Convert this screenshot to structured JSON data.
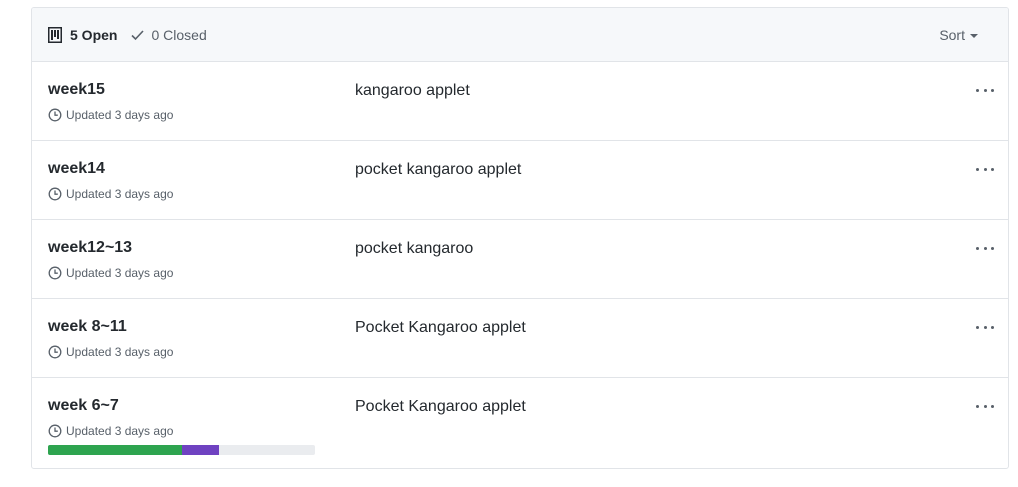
{
  "header": {
    "open_label": "5 Open",
    "closed_label": "0 Closed",
    "sort_label": "Sort"
  },
  "projects": [
    {
      "name": "week15",
      "updated": "Updated 3 days ago",
      "description": "kangaroo applet"
    },
    {
      "name": "week14",
      "updated": "Updated 3 days ago",
      "description": "pocket kangaroo applet"
    },
    {
      "name": "week12~13",
      "updated": "Updated 3 days ago",
      "description": "pocket kangaroo"
    },
    {
      "name": "week 8~11",
      "updated": "Updated 3 days ago",
      "description": "Pocket Kangaroo applet"
    },
    {
      "name": "week 6~7",
      "updated": "Updated 3 days ago",
      "description": "Pocket Kangaroo applet",
      "progress": {
        "done_fraction": 0.5,
        "in_progress_fraction": 0.14
      }
    }
  ],
  "colors": {
    "done": "#2ea44f",
    "in_progress": "#6f42c1",
    "remaining": "#eaecef"
  }
}
